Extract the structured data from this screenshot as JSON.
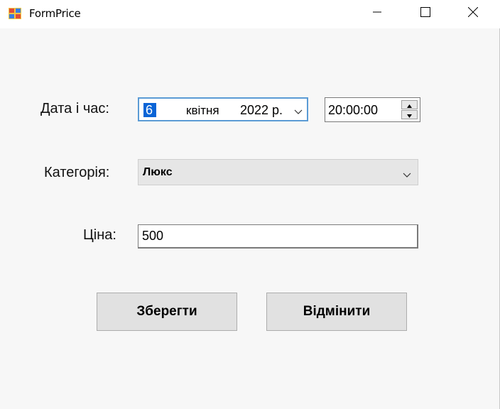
{
  "window": {
    "title": "FormPrice"
  },
  "form": {
    "datetime_label": "Дата і час:",
    "date": {
      "day": "6",
      "month": "квітня",
      "year": "2022 р."
    },
    "time": "20:00:00",
    "category_label": "Категорія:",
    "category_value": "Люкс",
    "price_label": "Ціна:",
    "price_value": "500"
  },
  "buttons": {
    "save_label": "Зберегти",
    "cancel_label": "Відмінити"
  },
  "colors": {
    "selection": "#0a64d6",
    "focus_border": "#5b9bd5",
    "button_bg": "#e1e1e1"
  }
}
